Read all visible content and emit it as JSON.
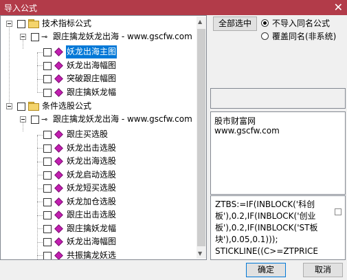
{
  "window": {
    "title": "导入公式",
    "close_glyph": "✕"
  },
  "tree": {
    "groups": [
      {
        "label": "技术指标公式",
        "subgroup": "跟庄擒龙妖龙出海 - www.gscfw.com",
        "items": [
          "妖龙出海主图",
          "妖龙出海幅图",
          "突破跟庄幅图",
          "跟庄擒妖龙幅"
        ]
      },
      {
        "label": "条件选股公式",
        "subgroup": "跟庄擒龙妖龙出海 - www.gscfw.com",
        "items": [
          "跟庄买选股",
          "妖龙出击选股",
          "妖龙出海选股",
          "妖龙启动选股",
          "妖龙短买选股",
          "妖龙加仓选股",
          "跟庄出击选股",
          "跟庄擒妖龙幅",
          "妖龙出海幅图",
          "共振擒龙妖选"
        ]
      }
    ],
    "selected_item": "妖龙出海主图"
  },
  "controls": {
    "select_all": "全部选中",
    "option_no_import": "不导入同名公式",
    "option_overwrite": "覆盖同名(非系统)",
    "selected_option": "option_no_import"
  },
  "info": {
    "line1": "股市财富网",
    "line2": "www.gscfw.com"
  },
  "code_text": "ZTBS:=IF(INBLOCK('科创板'),0.2,IF(INBLOCK('创业板'),0.2,IF(INBLOCK('ST板块'),0.05,0.1)));\nSTICKLINE((C>=ZTPRICE",
  "buttons": {
    "ok": "确定",
    "cancel": "取消"
  },
  "colors": {
    "titlebar": "#b23b49",
    "selection": "#0078d7"
  }
}
